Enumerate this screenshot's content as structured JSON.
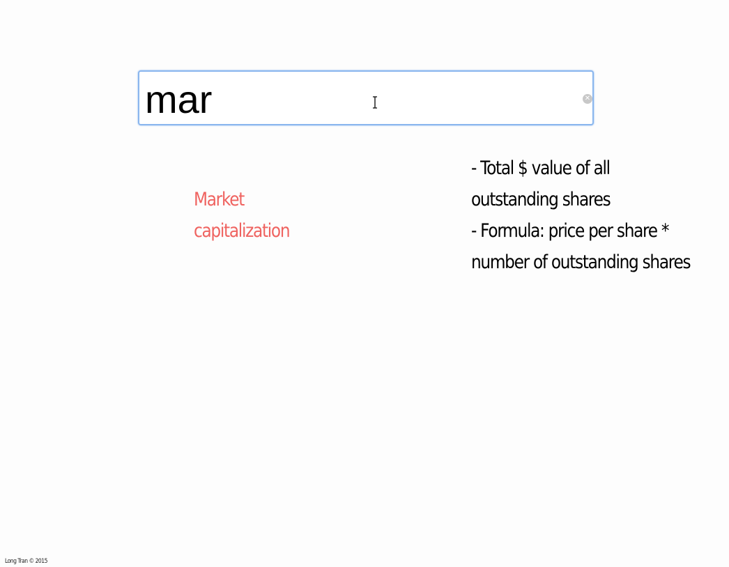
{
  "search": {
    "value": "mar"
  },
  "result": {
    "term_lines": [
      "Market",
      "capitalization"
    ],
    "definition_lines": [
      "- Total $ value of all",
      "outstanding shares",
      "- Formula: price per share *",
      "number of outstanding shares"
    ]
  },
  "footer": {
    "credit": "Long Tran © 2015"
  },
  "icons": {
    "clear": "clear-icon",
    "cursor": "text-cursor-icon"
  },
  "colors": {
    "focus_border": "#8ab6ee",
    "term": "#ef6360",
    "definition": "#000000",
    "background": "#fdfdfd"
  }
}
